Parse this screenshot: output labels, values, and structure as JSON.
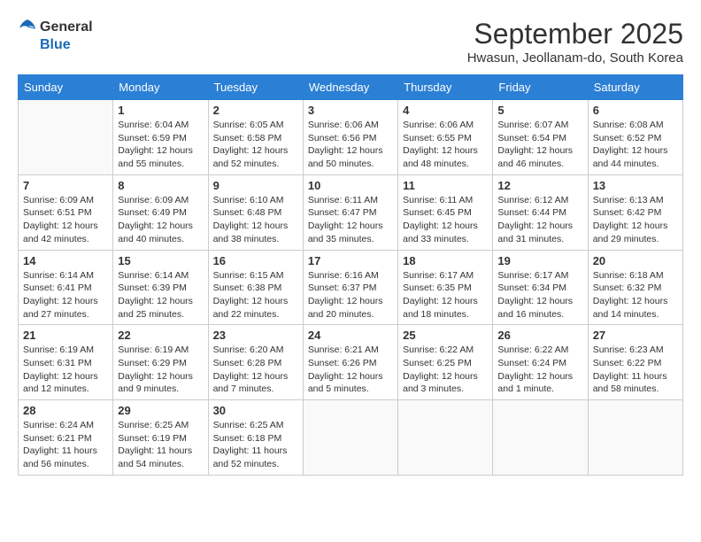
{
  "header": {
    "logo_general": "General",
    "logo_blue": "Blue",
    "month_title": "September 2025",
    "subtitle": "Hwasun, Jeollanam-do, South Korea"
  },
  "days_of_week": [
    "Sunday",
    "Monday",
    "Tuesday",
    "Wednesday",
    "Thursday",
    "Friday",
    "Saturday"
  ],
  "weeks": [
    [
      {
        "day": "",
        "info": ""
      },
      {
        "day": "1",
        "info": "Sunrise: 6:04 AM\nSunset: 6:59 PM\nDaylight: 12 hours\nand 55 minutes."
      },
      {
        "day": "2",
        "info": "Sunrise: 6:05 AM\nSunset: 6:58 PM\nDaylight: 12 hours\nand 52 minutes."
      },
      {
        "day": "3",
        "info": "Sunrise: 6:06 AM\nSunset: 6:56 PM\nDaylight: 12 hours\nand 50 minutes."
      },
      {
        "day": "4",
        "info": "Sunrise: 6:06 AM\nSunset: 6:55 PM\nDaylight: 12 hours\nand 48 minutes."
      },
      {
        "day": "5",
        "info": "Sunrise: 6:07 AM\nSunset: 6:54 PM\nDaylight: 12 hours\nand 46 minutes."
      },
      {
        "day": "6",
        "info": "Sunrise: 6:08 AM\nSunset: 6:52 PM\nDaylight: 12 hours\nand 44 minutes."
      }
    ],
    [
      {
        "day": "7",
        "info": "Sunrise: 6:09 AM\nSunset: 6:51 PM\nDaylight: 12 hours\nand 42 minutes."
      },
      {
        "day": "8",
        "info": "Sunrise: 6:09 AM\nSunset: 6:49 PM\nDaylight: 12 hours\nand 40 minutes."
      },
      {
        "day": "9",
        "info": "Sunrise: 6:10 AM\nSunset: 6:48 PM\nDaylight: 12 hours\nand 38 minutes."
      },
      {
        "day": "10",
        "info": "Sunrise: 6:11 AM\nSunset: 6:47 PM\nDaylight: 12 hours\nand 35 minutes."
      },
      {
        "day": "11",
        "info": "Sunrise: 6:11 AM\nSunset: 6:45 PM\nDaylight: 12 hours\nand 33 minutes."
      },
      {
        "day": "12",
        "info": "Sunrise: 6:12 AM\nSunset: 6:44 PM\nDaylight: 12 hours\nand 31 minutes."
      },
      {
        "day": "13",
        "info": "Sunrise: 6:13 AM\nSunset: 6:42 PM\nDaylight: 12 hours\nand 29 minutes."
      }
    ],
    [
      {
        "day": "14",
        "info": "Sunrise: 6:14 AM\nSunset: 6:41 PM\nDaylight: 12 hours\nand 27 minutes."
      },
      {
        "day": "15",
        "info": "Sunrise: 6:14 AM\nSunset: 6:39 PM\nDaylight: 12 hours\nand 25 minutes."
      },
      {
        "day": "16",
        "info": "Sunrise: 6:15 AM\nSunset: 6:38 PM\nDaylight: 12 hours\nand 22 minutes."
      },
      {
        "day": "17",
        "info": "Sunrise: 6:16 AM\nSunset: 6:37 PM\nDaylight: 12 hours\nand 20 minutes."
      },
      {
        "day": "18",
        "info": "Sunrise: 6:17 AM\nSunset: 6:35 PM\nDaylight: 12 hours\nand 18 minutes."
      },
      {
        "day": "19",
        "info": "Sunrise: 6:17 AM\nSunset: 6:34 PM\nDaylight: 12 hours\nand 16 minutes."
      },
      {
        "day": "20",
        "info": "Sunrise: 6:18 AM\nSunset: 6:32 PM\nDaylight: 12 hours\nand 14 minutes."
      }
    ],
    [
      {
        "day": "21",
        "info": "Sunrise: 6:19 AM\nSunset: 6:31 PM\nDaylight: 12 hours\nand 12 minutes."
      },
      {
        "day": "22",
        "info": "Sunrise: 6:19 AM\nSunset: 6:29 PM\nDaylight: 12 hours\nand 9 minutes."
      },
      {
        "day": "23",
        "info": "Sunrise: 6:20 AM\nSunset: 6:28 PM\nDaylight: 12 hours\nand 7 minutes."
      },
      {
        "day": "24",
        "info": "Sunrise: 6:21 AM\nSunset: 6:26 PM\nDaylight: 12 hours\nand 5 minutes."
      },
      {
        "day": "25",
        "info": "Sunrise: 6:22 AM\nSunset: 6:25 PM\nDaylight: 12 hours\nand 3 minutes."
      },
      {
        "day": "26",
        "info": "Sunrise: 6:22 AM\nSunset: 6:24 PM\nDaylight: 12 hours\nand 1 minute."
      },
      {
        "day": "27",
        "info": "Sunrise: 6:23 AM\nSunset: 6:22 PM\nDaylight: 11 hours\nand 58 minutes."
      }
    ],
    [
      {
        "day": "28",
        "info": "Sunrise: 6:24 AM\nSunset: 6:21 PM\nDaylight: 11 hours\nand 56 minutes."
      },
      {
        "day": "29",
        "info": "Sunrise: 6:25 AM\nSunset: 6:19 PM\nDaylight: 11 hours\nand 54 minutes."
      },
      {
        "day": "30",
        "info": "Sunrise: 6:25 AM\nSunset: 6:18 PM\nDaylight: 11 hours\nand 52 minutes."
      },
      {
        "day": "",
        "info": ""
      },
      {
        "day": "",
        "info": ""
      },
      {
        "day": "",
        "info": ""
      },
      {
        "day": "",
        "info": ""
      }
    ]
  ]
}
